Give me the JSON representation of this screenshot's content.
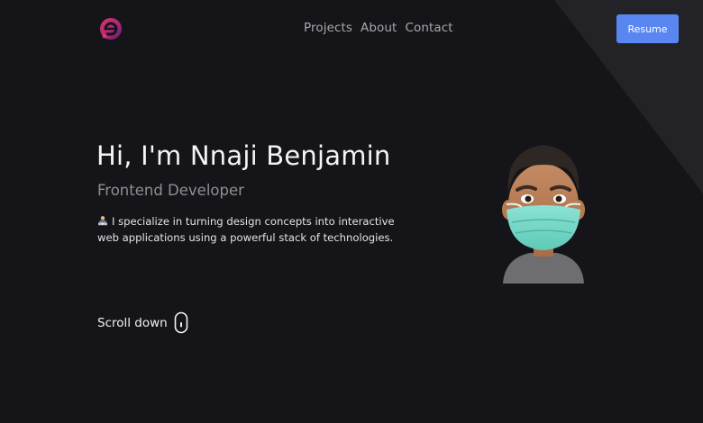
{
  "header": {
    "nav": [
      {
        "label": "Projects"
      },
      {
        "label": "About"
      },
      {
        "label": "Contact"
      }
    ],
    "resume_label": "Resume"
  },
  "hero": {
    "title": "Hi, I'm Nnaji Benjamin",
    "subtitle": "Frontend Developer",
    "description": "I specialize in turning design concepts into interactive web applications using a powerful stack of technologies."
  },
  "scroll": {
    "label": "Scroll down"
  },
  "colors": {
    "background": "#151519",
    "accent": "#5a86f2",
    "corner": "#232327",
    "muted_text": "#8e8e94"
  },
  "icons": [
    "logo-icon",
    "technologist-emoji-icon",
    "mouse-icon",
    "avatar-memoji"
  ]
}
